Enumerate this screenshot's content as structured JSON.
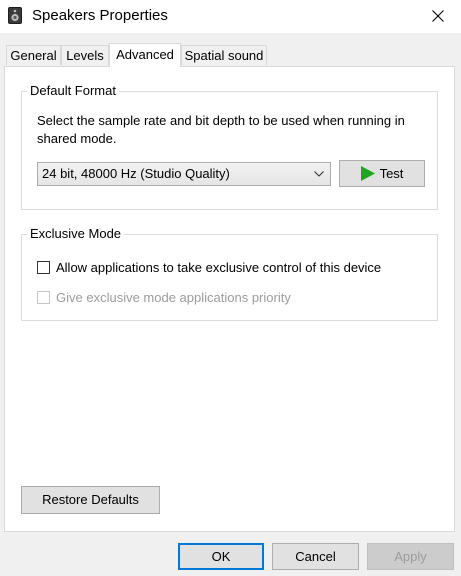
{
  "window": {
    "title": "Speakers Properties",
    "icon": "speaker-icon",
    "close_icon": "close-icon"
  },
  "tabs": [
    {
      "label": "General",
      "active": false
    },
    {
      "label": "Levels",
      "active": false
    },
    {
      "label": "Advanced",
      "active": true
    },
    {
      "label": "Spatial sound",
      "active": false
    }
  ],
  "default_format": {
    "legend": "Default Format",
    "description_line1": "Select the sample rate and bit depth to be used when running in",
    "description_line2": "shared mode.",
    "selected_format": "24 bit, 48000 Hz (Studio Quality)",
    "dropdown_icon": "chevron-down-icon",
    "test_label": "Test",
    "test_icon": "play-icon",
    "accent_color": "#22a322"
  },
  "exclusive_mode": {
    "legend": "Exclusive Mode",
    "allow_label": "Allow applications to take exclusive control of this device",
    "allow_checked": false,
    "priority_label": "Give exclusive mode applications priority",
    "priority_checked": false,
    "priority_enabled": false
  },
  "restore_defaults_label": "Restore Defaults",
  "footer": {
    "ok_label": "OK",
    "cancel_label": "Cancel",
    "apply_label": "Apply",
    "apply_enabled": false,
    "default_button_color": "#0078d7"
  }
}
